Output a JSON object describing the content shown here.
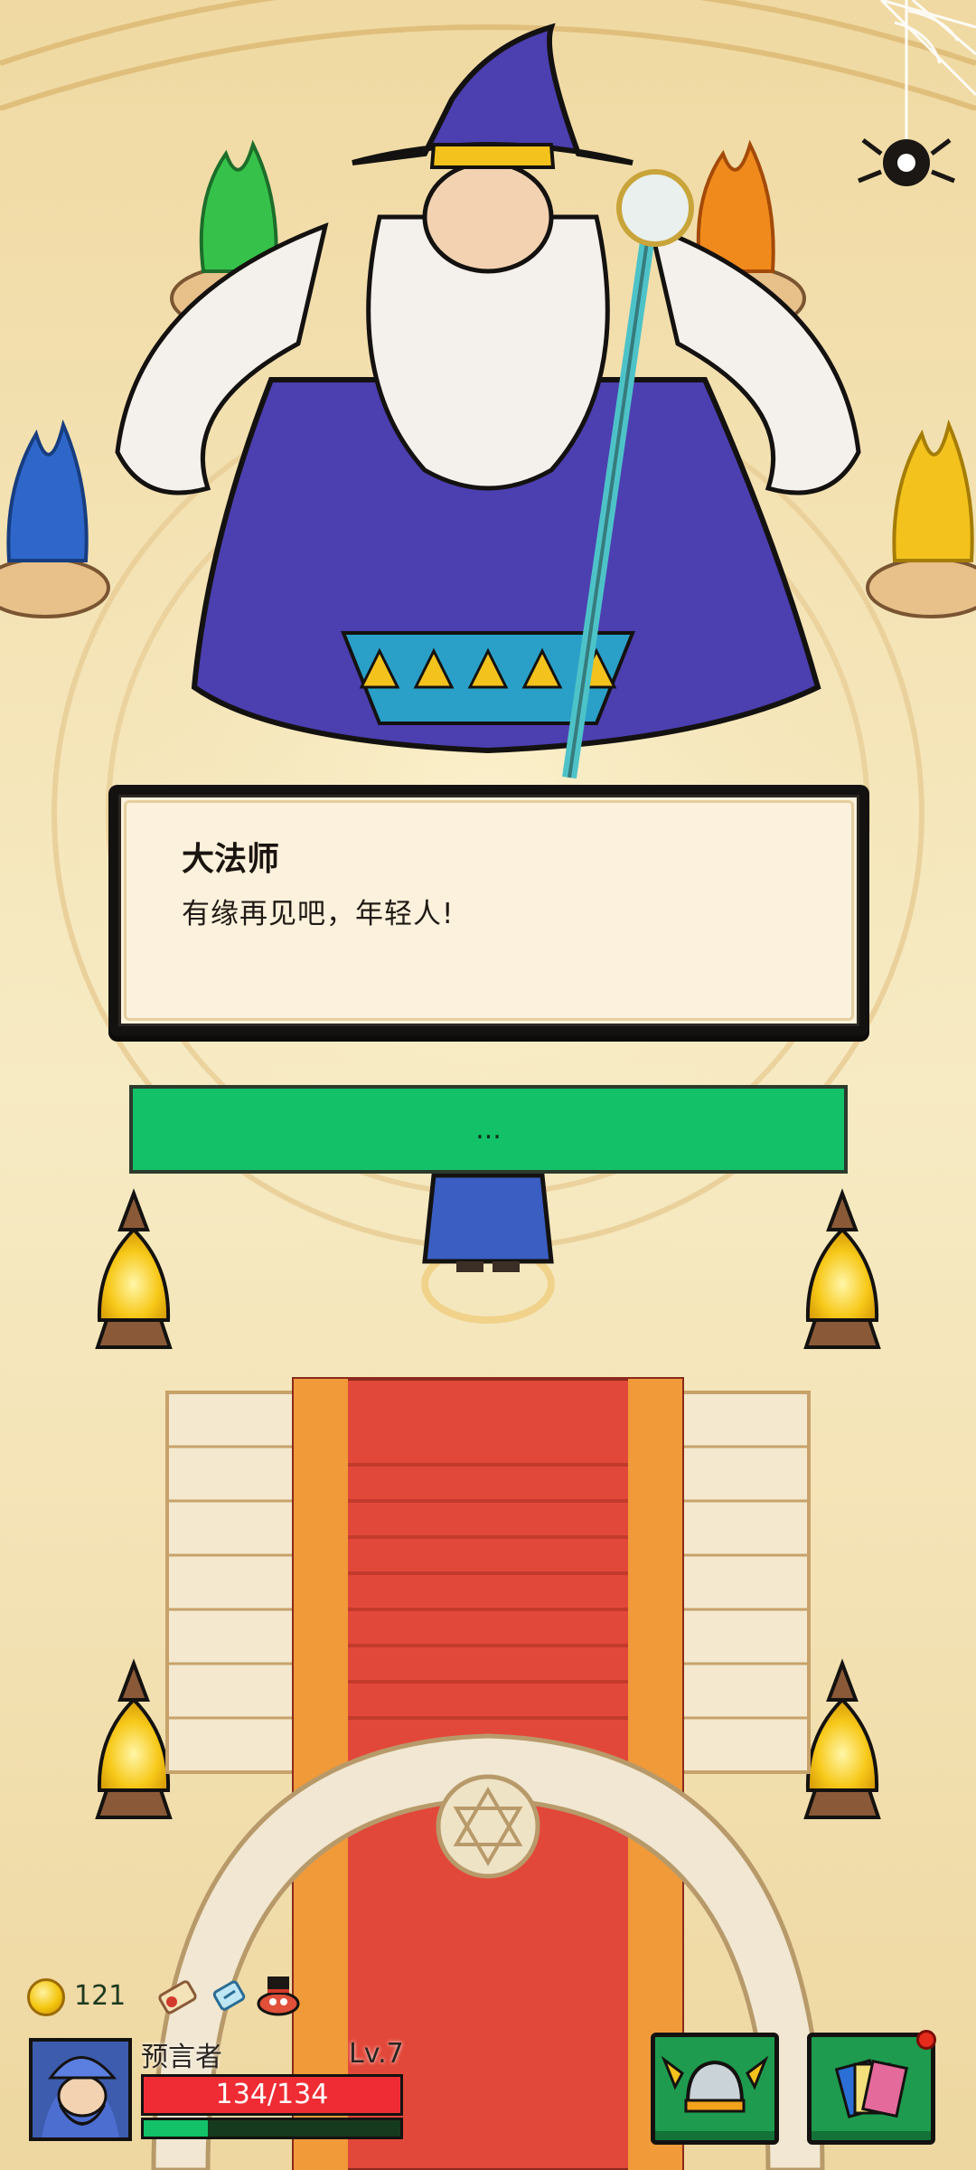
{
  "dialog": {
    "speaker": "大法师",
    "text": "有缘再见吧，年轻人!"
  },
  "choice": {
    "label": "..."
  },
  "hud": {
    "gold": "121",
    "player_name": "预言者",
    "level": "Lv.7",
    "hp_text": "134/134",
    "hp_fraction": 1.0,
    "xp_fraction": 0.25,
    "buff_icons": [
      "scroll-icon",
      "ice-crystal-icon",
      "frog-hat-icon"
    ],
    "buttons": [
      {
        "name": "equipment-button",
        "icon": "winged-helmet-icon"
      },
      {
        "name": "cards-button",
        "icon": "card-deck-icon",
        "notification": true
      }
    ]
  }
}
